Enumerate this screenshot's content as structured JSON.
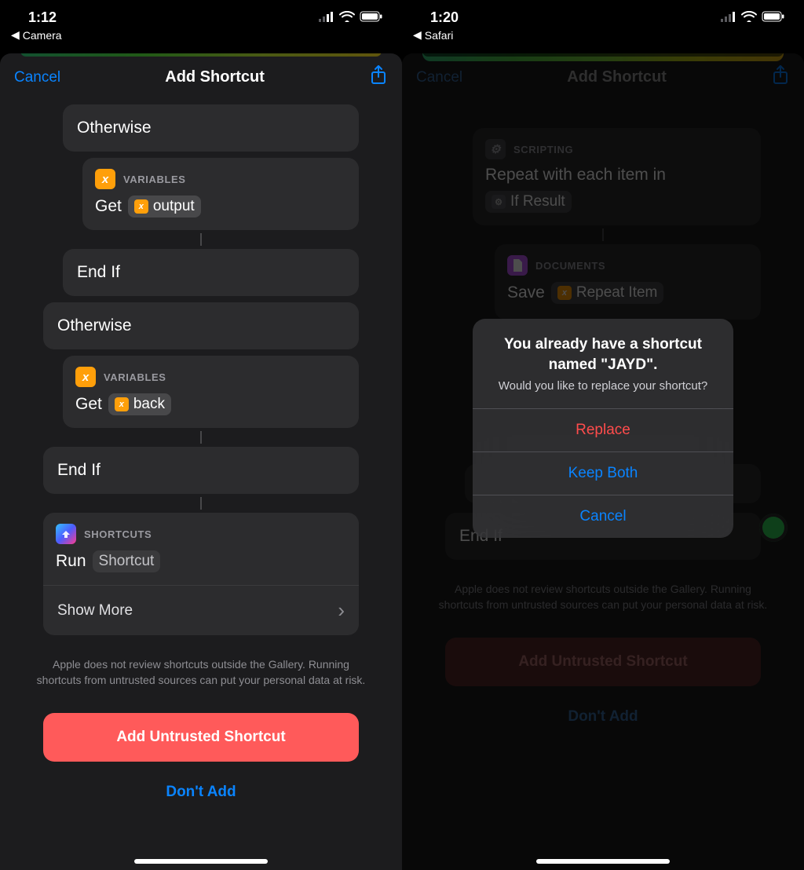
{
  "left": {
    "status": {
      "time": "1:12",
      "back_label": "Camera"
    },
    "nav": {
      "cancel": "Cancel",
      "title": "Add Shortcut"
    },
    "flow": {
      "otherwise1": "Otherwise",
      "var1": {
        "category": "VARIABLES",
        "action": "Get",
        "pill": "output"
      },
      "endif1": "End If",
      "otherwise2": "Otherwise",
      "var2": {
        "category": "VARIABLES",
        "action": "Get",
        "pill": "back"
      },
      "endif2": "End If",
      "run": {
        "category": "SHORTCUTS",
        "action": "Run",
        "pill": "Shortcut",
        "showmore": "Show More"
      }
    },
    "disclaimer": "Apple does not review shortcuts outside the Gallery. Running shortcuts from untrusted sources can put your personal data at risk.",
    "primary_btn": "Add Untrusted Shortcut",
    "secondary_btn": "Don't Add"
  },
  "right": {
    "status": {
      "time": "1:20",
      "back_label": "Safari"
    },
    "nav": {
      "cancel": "Cancel",
      "title": "Add Shortcut"
    },
    "flow": {
      "repeat": {
        "category": "SCRIPTING",
        "line": "Repeat with each item in",
        "pill": "If Result"
      },
      "save": {
        "category": "DOCUMENTS",
        "action": "Save",
        "pill": "Repeat Item"
      },
      "endif": "End If"
    },
    "alert": {
      "title": "You already have a shortcut named \"JAYD\".",
      "message": "Would you like to replace your shortcut?",
      "replace": "Replace",
      "keep": "Keep Both",
      "cancel": "Cancel"
    },
    "disclaimer": "Apple does not review shortcuts outside the Gallery. Running shortcuts from untrusted sources can put your personal data at risk.",
    "primary_btn": "Add Untrusted Shortcut",
    "secondary_btn": "Don't Add"
  }
}
